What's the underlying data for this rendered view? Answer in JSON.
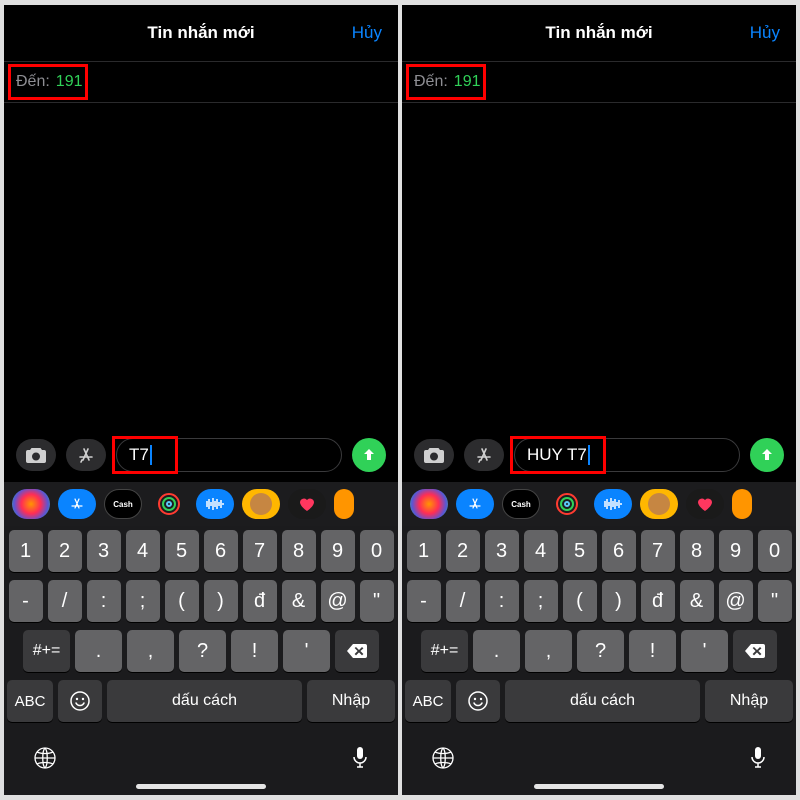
{
  "screens": [
    {
      "header": {
        "title": "Tin nhắn mới",
        "cancel": "Hủy"
      },
      "to": {
        "label": "Đến:",
        "value": "191"
      },
      "input": {
        "text": "T7"
      },
      "highlight_box": {
        "to_field": true,
        "input_field": true
      }
    },
    {
      "header": {
        "title": "Tin nhắn mới",
        "cancel": "Hủy"
      },
      "to": {
        "label": "Đến:",
        "value": "191"
      },
      "input": {
        "text": "HUY T7"
      },
      "highlight_box": {
        "to_field": true,
        "input_field": true
      }
    }
  ],
  "app_strip": {
    "cash_label": "Cash"
  },
  "keyboard": {
    "row1": [
      "1",
      "2",
      "3",
      "4",
      "5",
      "6",
      "7",
      "8",
      "9",
      "0"
    ],
    "row2": [
      "-",
      "/",
      ":",
      ";",
      "(",
      ")",
      "đ",
      "&",
      "@",
      "\""
    ],
    "row3_shift": "#+=",
    "row3": [
      ".",
      ",",
      "?",
      "!",
      "'"
    ],
    "abc": "ABC",
    "space": "dấu cách",
    "return": "Nhập"
  },
  "icons": {
    "camera": "camera-icon",
    "appstore": "appstore-icon",
    "send": "arrow-up-icon",
    "globe": "globe-icon",
    "mic": "mic-icon",
    "emoji": "emoji-icon",
    "delete": "delete-icon"
  },
  "colors": {
    "accent_blue": "#0a84ff",
    "accent_green": "#30d158",
    "highlight_red": "#ff0000"
  }
}
